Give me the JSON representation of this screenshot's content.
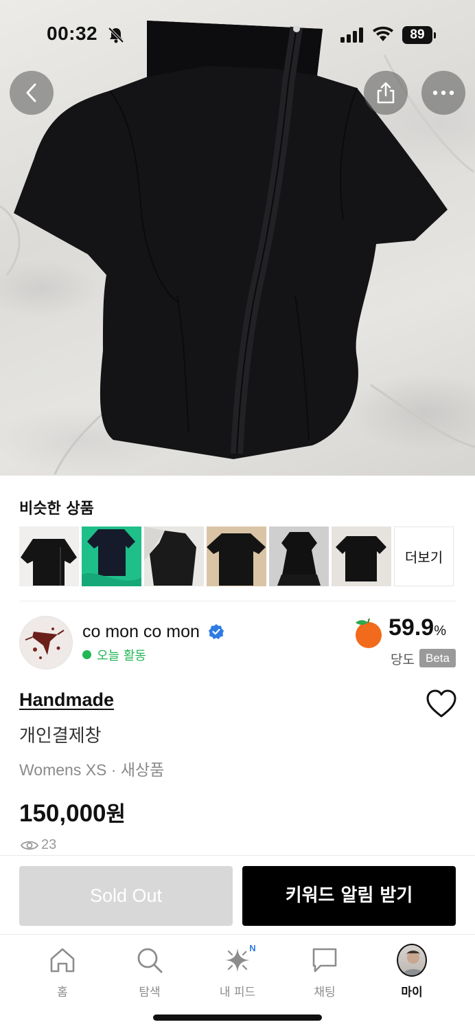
{
  "status_bar": {
    "time": "00:32",
    "battery": "89"
  },
  "similar": {
    "title": "비슷한 상품",
    "more_label": "더보기",
    "thumbs": [
      {
        "name": "similar-thumb-1",
        "bg": "#f0efed"
      },
      {
        "name": "similar-thumb-2",
        "bg": "#1fbf8a"
      },
      {
        "name": "similar-thumb-3",
        "bg": "#e8e7e4"
      },
      {
        "name": "similar-thumb-4",
        "bg": "#d9c4a5"
      },
      {
        "name": "similar-thumb-5",
        "bg": "#cfcfcf"
      },
      {
        "name": "similar-thumb-6",
        "bg": "#e6e3df"
      }
    ]
  },
  "seller": {
    "name": "co mon co mon",
    "activity": "오늘 활동",
    "sweetness_value": "59.9",
    "sweetness_unit": "%",
    "sweetness_label": "당도",
    "beta": "Beta"
  },
  "product": {
    "brand": "Handmade",
    "title": "개인결제창",
    "meta": "Womens XS · 새상품",
    "price_number": "150,000",
    "price_unit": "원",
    "views": "23"
  },
  "actions": {
    "sold_out": "Sold Out",
    "keyword_alert": "키워드 알림 받기"
  },
  "tabs": [
    {
      "label": "홈",
      "icon": "home-icon"
    },
    {
      "label": "탐색",
      "icon": "search-icon"
    },
    {
      "label": "내 피드",
      "icon": "sparkle-icon",
      "badge": "N"
    },
    {
      "label": "채팅",
      "icon": "chat-bubble-icon"
    },
    {
      "label": "마이",
      "icon": "avatar",
      "active": true
    }
  ],
  "colors": {
    "accent_green": "#22b655",
    "verified_blue": "#2d7be5",
    "primary_button": "#000000",
    "disabled_button": "#d8d8d8"
  }
}
